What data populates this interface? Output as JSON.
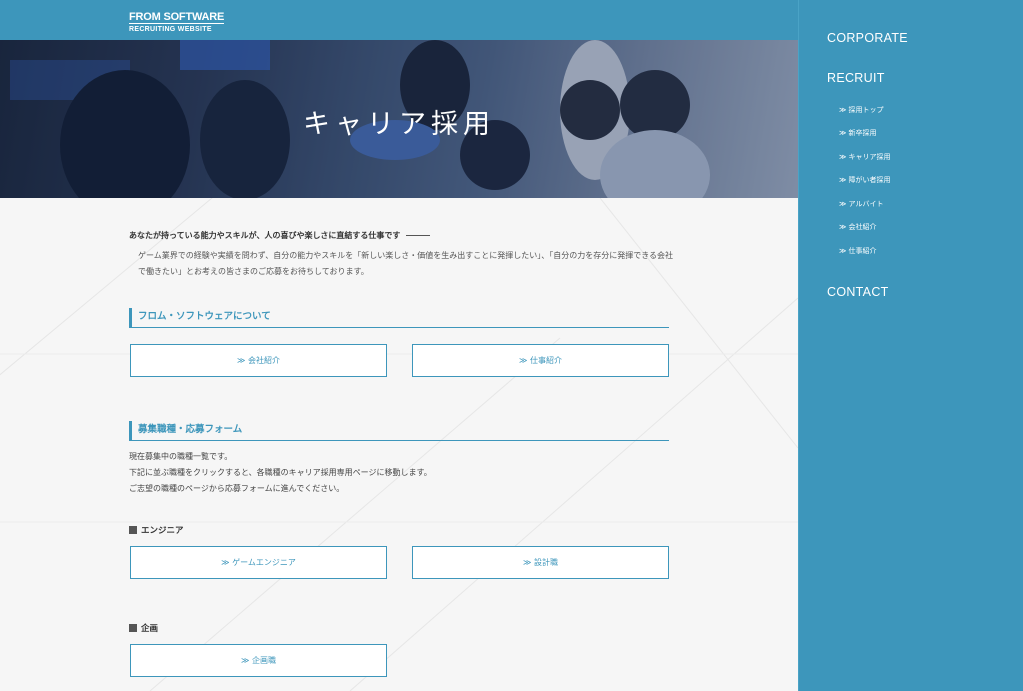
{
  "header": {
    "logo_main": "FROM SOFTWARE",
    "logo_sub": "RECRUITING WEBSITE"
  },
  "hero": {
    "title": "キャリア採用"
  },
  "intro": {
    "lead": "あなたが持っている能力やスキルが、人の喜びや楽しさに直結する仕事です",
    "body": "ゲーム業界での経験や実績を問わず、自分の能力やスキルを「新しい楽しさ・価値を生み出すことに発揮したい」、「自分の力を存分に発揮できる会社で働きたい」とお考えの皆さまのご応募をお待ちしております。"
  },
  "about": {
    "heading": "フロム・ソフトウェアについて",
    "buttons": [
      "≫ 会社紹介",
      "≫ 仕事紹介"
    ]
  },
  "recruit": {
    "heading": "募集職種・応募フォーム",
    "lines": [
      "現在募集中の職種一覧です。",
      "下記に並ぶ職種をクリックすると、各職種のキャリア採用専用ページに移動します。",
      "ご志望の職種のページから応募フォームに進んでください。"
    ],
    "categories": [
      {
        "label": "エンジニア",
        "buttons": [
          "≫ ゲームエンジニア",
          "≫ 設計職"
        ]
      },
      {
        "label": "企画",
        "buttons": [
          "≫ 企画職"
        ]
      }
    ]
  },
  "sidebar": {
    "corporate": "CORPORATE",
    "recruit": "RECRUIT",
    "items": [
      "≫ 採用トップ",
      "≫ 新卒採用",
      "≫ キャリア採用",
      "≫ 障がい者採用",
      "≫ アルバイト",
      "≫ 会社紹介",
      "≫ 仕事紹介"
    ],
    "contact": "CONTACT"
  },
  "colors": {
    "accent": "#3d96bb",
    "page_bg": "#f6f6f6"
  }
}
